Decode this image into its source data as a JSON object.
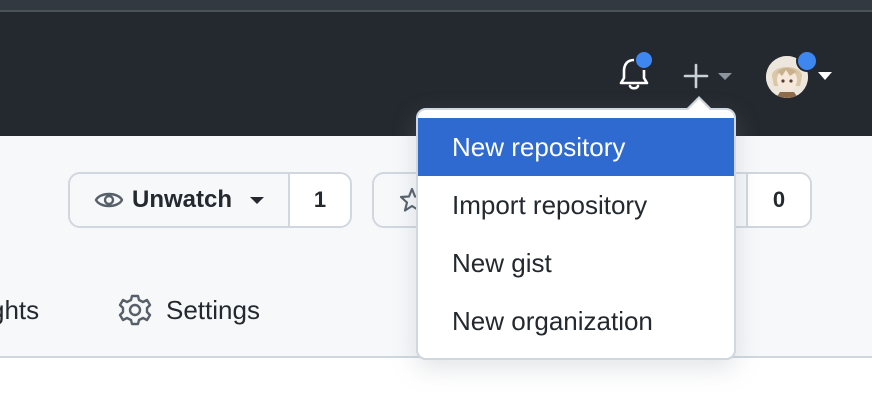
{
  "header": {
    "notifications_icon": "bell-icon",
    "create_icon": "plus-icon",
    "avatar_icon": "user-avatar"
  },
  "repo_actions": {
    "watch": {
      "label": "Unwatch",
      "count": "1",
      "icon": "eye-icon"
    },
    "star": {
      "count": "0",
      "icon": "star-icon"
    }
  },
  "tabs": [
    {
      "label": "ghts"
    },
    {
      "label": "Settings",
      "icon": "gear-icon"
    }
  ],
  "create_menu": {
    "items": [
      {
        "label": "New repository",
        "active": true
      },
      {
        "label": "Import repository"
      },
      {
        "label": "New gist"
      },
      {
        "label": "New organization"
      }
    ]
  },
  "colors": {
    "header_bg": "#24292f",
    "accent": "#2f6ad0",
    "notification_dot": "#3e86f0",
    "border": "#d0d7de"
  }
}
